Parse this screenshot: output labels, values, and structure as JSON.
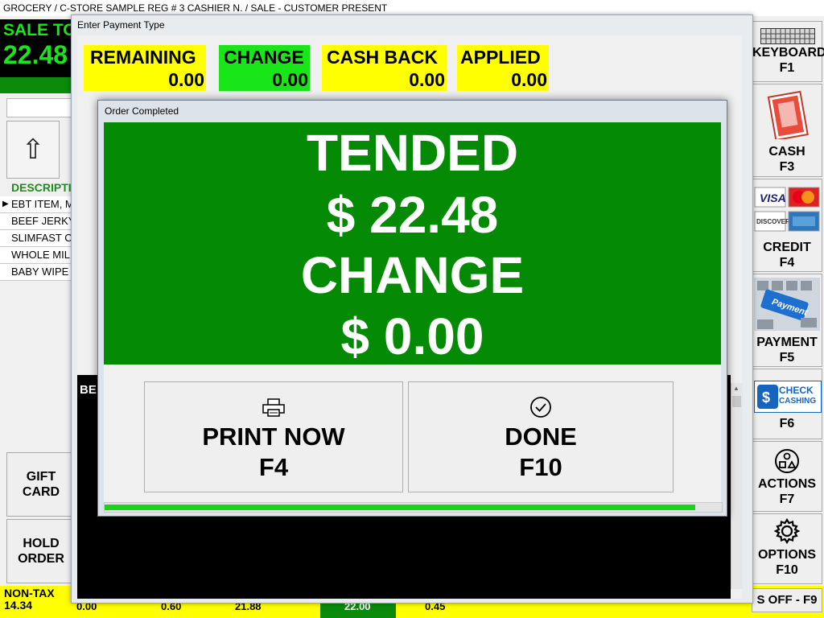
{
  "topbar": {
    "text": "GROCERY / C-STORE SAMPLE REG # 3 CASHIER N. /  SALE - CUSTOMER PRESENT"
  },
  "left_panel": {
    "sale_total_label": "SALE TO",
    "sale_total_value": "22.48",
    "desc_header": "DESCRIPTIO",
    "items": [
      "EBT ITEM, M",
      "BEEF JERKY",
      "SLIMFAST C",
      "WHOLE MIL",
      "BABY WIPE"
    ],
    "gift_card": [
      "GIFT",
      "CARD"
    ],
    "hold_order": [
      "HOLD",
      "ORDER"
    ],
    "table_fragment": "BE"
  },
  "bottom_bar": {
    "nontax_label": "NON-TAX",
    "nontax_value": "14.34",
    "values": [
      "0.00",
      "0.60",
      "21.88",
      "22.00",
      "0.45"
    ],
    "right_label": "S OFF - F9"
  },
  "function_buttons": [
    {
      "label": "KEYBOARD",
      "key": "F1",
      "icon": "keyboard-icon"
    },
    {
      "label": "CASH",
      "key": "F3",
      "icon": "cash-icon"
    },
    {
      "label": "CREDIT",
      "key": "F4",
      "icon": "credit-cards-icon"
    },
    {
      "label": "PAYMENT",
      "key": "F5",
      "icon": "payment-key-icon"
    },
    {
      "label": "",
      "key": "F6",
      "icon": "check-cashing-icon",
      "logo_text": [
        "CHECK",
        "CASHING"
      ]
    },
    {
      "label": "ACTIONS",
      "key": "F7",
      "icon": "actions-icon"
    },
    {
      "label": "OPTIONS",
      "key": "F10",
      "icon": "gear-icon"
    }
  ],
  "payment_window": {
    "title": "Enter Payment Type",
    "boxes": [
      {
        "label": "REMAINING",
        "value": "0.00",
        "color": "#ffff00"
      },
      {
        "label": "CHANGE",
        "value": "0.00",
        "color": "#19e619"
      },
      {
        "label": "CASH BACK",
        "value": "0.00",
        "color": "#ffff00"
      },
      {
        "label": "APPLIED",
        "value": "0.00",
        "color": "#ffff00"
      }
    ]
  },
  "order_dialog": {
    "title": "Order Completed",
    "tended_label": "TENDED",
    "tended_value": "$ 22.48",
    "change_label": "CHANGE",
    "change_value": "$ 0.00",
    "print_button": {
      "line1": "PRINT NOW",
      "line2": "F4",
      "icon": "printer-icon"
    },
    "done_button": {
      "line1": "DONE",
      "line2": "F10",
      "icon": "check-circle-icon"
    },
    "progress": 0.96,
    "green": "#048a04"
  }
}
